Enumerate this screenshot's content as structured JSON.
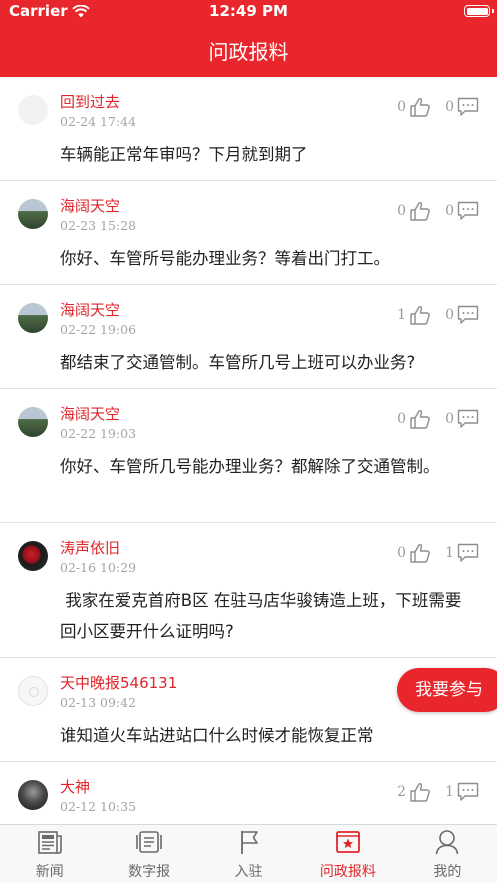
{
  "status_bar": {
    "carrier": "Carrier",
    "time": "12:49 PM"
  },
  "header": {
    "title": "问政报料"
  },
  "posts": [
    {
      "user": "回到过去",
      "time": "02-24 17:44",
      "content": "车辆能正常年审吗？下月就到期了",
      "likes": "0",
      "comments": "0",
      "avatar": "blank-avatar"
    },
    {
      "user": "海阔天空",
      "time": "02-23 15:28",
      "content": "你好、车管所号能办理业务？等着出门打工。",
      "likes": "0",
      "comments": "0",
      "avatar": "landscape-avatar"
    },
    {
      "user": "海阔天空",
      "time": "02-22 19:06",
      "content": "都结束了交通管制。车管所几号上班可以办业务?",
      "likes": "1",
      "comments": "0",
      "avatar": "landscape-avatar"
    },
    {
      "user": "海阔天空",
      "time": "02-22 19:03",
      "content": "你好、车管所几号能办理业务？都解除了交通管制。",
      "likes": "0",
      "comments": "0",
      "avatar": "landscape-avatar"
    },
    {
      "user": "涛声依旧",
      "time": "02-16 10:29",
      "content": " 我家在爱克首府B区 在驻马店华骏铸造上班，下班需要回小区要开什么证明吗?",
      "likes": "0",
      "comments": "1",
      "avatar": "rose-avatar"
    },
    {
      "user": "天中晚报546131",
      "time": "02-13 09:42",
      "content": "谁知道火车站进站口什么时候才能恢复正常",
      "likes": "",
      "comments": "",
      "avatar": "moon-avatar"
    },
    {
      "user": "大神",
      "time": "02-12 10:35",
      "content": "",
      "likes": "2",
      "comments": "1",
      "avatar": "person-avatar"
    }
  ],
  "float_button": {
    "label": "我要参与"
  },
  "tabs": [
    {
      "label": "新闻",
      "icon": "newspaper-icon"
    },
    {
      "label": "数字报",
      "icon": "digital-paper-icon"
    },
    {
      "label": "入驻",
      "icon": "flag-icon"
    },
    {
      "label": "问政报料",
      "icon": "report-icon",
      "active": true
    },
    {
      "label": "我的",
      "icon": "profile-icon"
    }
  ],
  "colors": {
    "brand_red": "#e8262b",
    "username_red": "#e0262a",
    "time_gray": "#a4a4a4",
    "text_dark": "#222222"
  }
}
